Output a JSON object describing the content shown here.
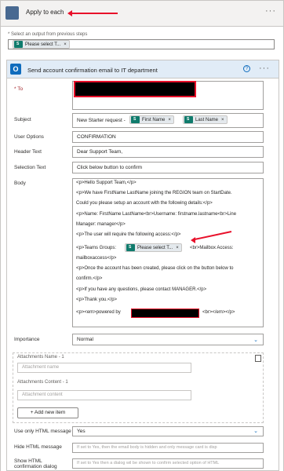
{
  "loop": {
    "title": "Apply to each",
    "select_label": "* Select an output from previous steps",
    "output_token": "Please select T..."
  },
  "action": {
    "title": "Send account confirmation email to IT department",
    "help": "?",
    "more": "···"
  },
  "fields": {
    "to_label": "* To",
    "subject_label": "Subject",
    "subject_prefix": "New Starter request -",
    "subject_tokens": [
      "First Name",
      "Last Name"
    ],
    "user_options_label": "User Options",
    "user_options_value": "CONFIRMATION",
    "header_text_label": "Header Text",
    "header_text_value": "Dear Support Team,",
    "selection_text_label": "Selection Text",
    "selection_text_value": "Click below button to confirm",
    "body_label": "Body",
    "body_lines": [
      "<p>Hello Support Team,</p>",
      "<p>We have FirstName LastName joining the REGION team on StartDate.",
      "Could you please setup an account with the following details:</p>",
      "<p>Name: FirstName LastName<br>Username: firstname.lastname<br>Line",
      "Manager: manager</p>",
      "<p>The user will require the following access:</p>"
    ],
    "body_teams_prefix": "<p>Teams Groups:",
    "body_teams_token": "Please select T...",
    "body_teams_suffix": "<br>Mailbox Access:",
    "body_lines_after": [
      "mailboxaccess</p>",
      "<p>Once the account has been created, please click on the button below to",
      "confirm.</p>",
      "<p>If you have any questions, please contact MANAGER.</p>",
      "<p>Thank you.</p>"
    ],
    "body_powered_prefix": "<p><em>powered by",
    "body_powered_suffix": "<br></em></p>",
    "importance_label": "Importance",
    "importance_value": "Normal",
    "attachments_name_label": "Attachments Name - 1",
    "attachment_name_placeholder": "Attachment name",
    "attachments_content_label": "Attachments Content - 1",
    "attachment_content_placeholder": "Attachment content",
    "add_item_label": "+ Add new item",
    "use_html_label": "Use only HTML message",
    "use_html_value": "Yes",
    "hide_html_label": "Hide HTML message",
    "hide_html_placeholder": "If set to Yes, then the email body is hidden and only message card is disp",
    "show_html_label": "Show HTML confirmation dialog",
    "show_html_placeholder": "If set to Yes then a dialog wil be shown to confirm selected option of HTML"
  },
  "colors": {
    "accent": "#0f6cbd",
    "annotation_red": "#e8102a",
    "token_bg": "#e4e9ed"
  }
}
